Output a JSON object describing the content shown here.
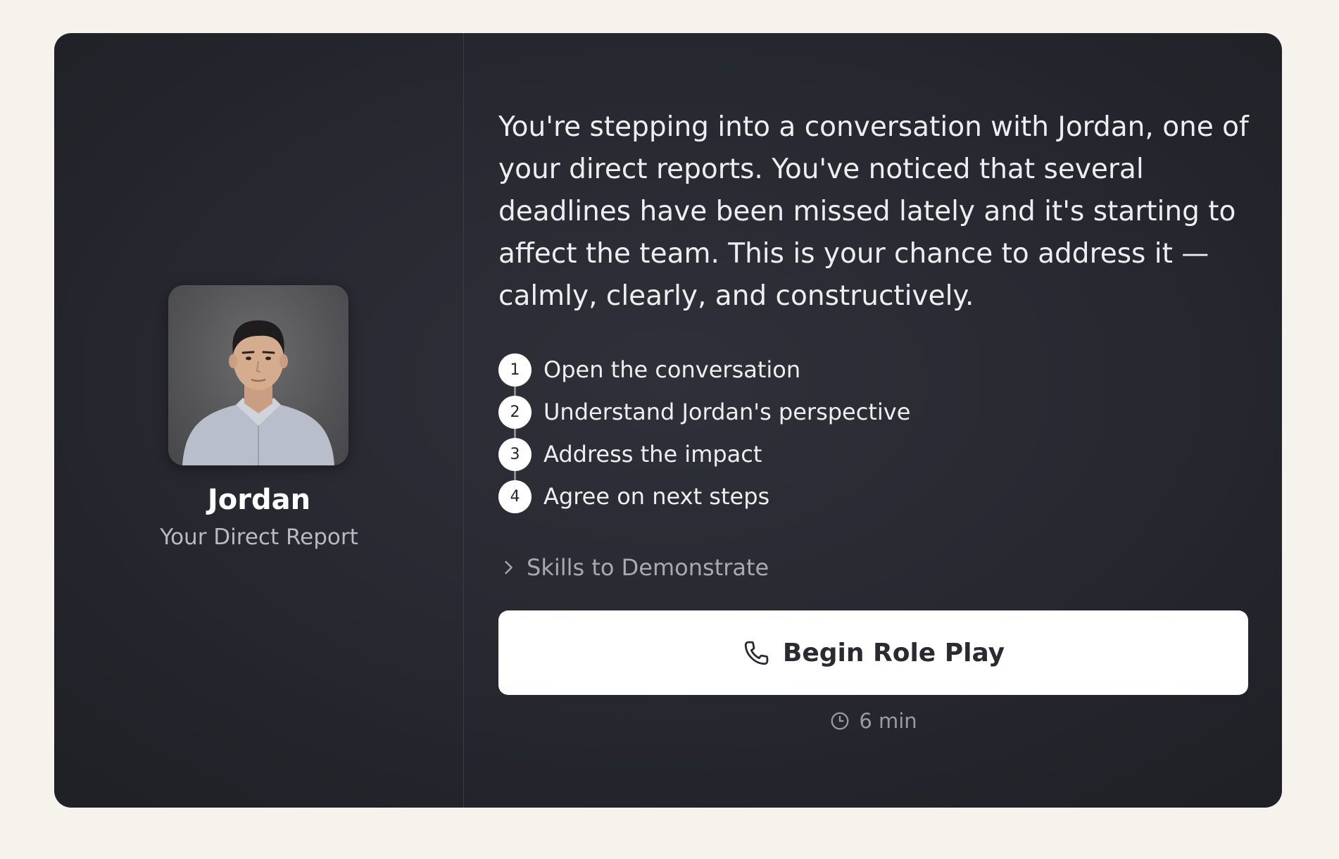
{
  "persona": {
    "name": "Jordan",
    "role": "Your Direct Report"
  },
  "intro": "You're stepping into a conversation with Jordan, one of your direct reports. You've noticed that several deadlines have been missed lately and it's starting to affect the team. This is your chance to address it — calmly, clearly, and constructively.",
  "steps": [
    {
      "number": "1",
      "label": "Open the conversation"
    },
    {
      "number": "2",
      "label": "Understand Jordan's perspective"
    },
    {
      "number": "3",
      "label": "Address the impact"
    },
    {
      "number": "4",
      "label": "Agree on next steps"
    }
  ],
  "skills_toggle": {
    "label": "Skills to Demonstrate",
    "icon": "chevron-right-icon"
  },
  "begin_button": {
    "label": "Begin Role Play",
    "icon": "phone-icon"
  },
  "duration": {
    "label": "6 min",
    "icon": "clock-icon"
  },
  "colors": {
    "page_background": "#f6f3ec",
    "card_background": "#27282f",
    "button_background": "#ffffff"
  }
}
